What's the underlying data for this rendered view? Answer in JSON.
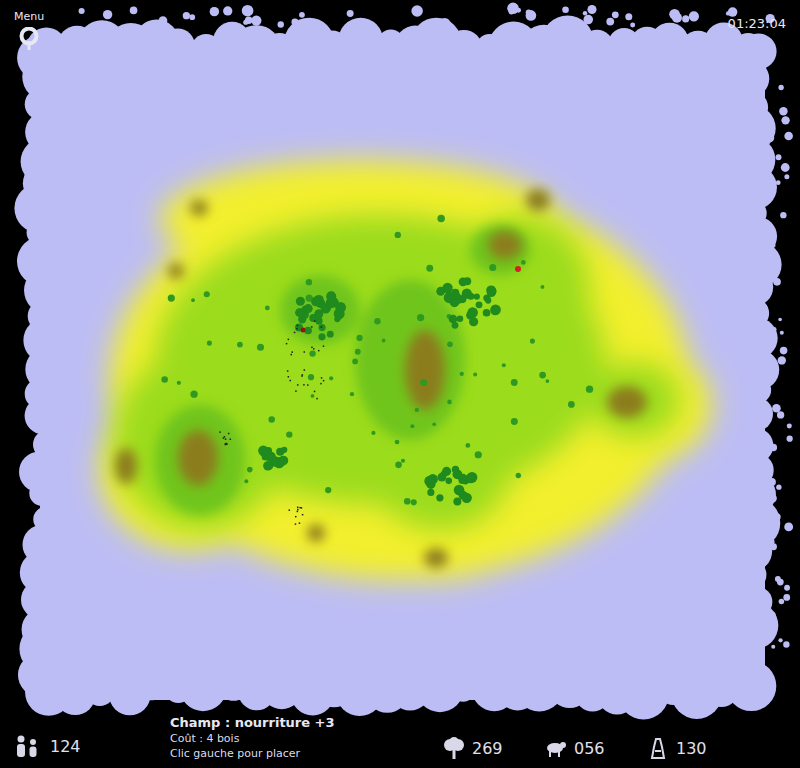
{
  "menu": {
    "label": "Menu"
  },
  "timer": "01:23:04",
  "population": "124",
  "tooltip": {
    "title": "Champ : nourriture +3",
    "cost": "Coût : 4 bois",
    "hint": "Clic gauche pour placer"
  },
  "resources": [
    {
      "kind": "wood",
      "value": "269"
    },
    {
      "kind": "sheep",
      "value": "056"
    },
    {
      "kind": "stone",
      "value": "130"
    }
  ]
}
